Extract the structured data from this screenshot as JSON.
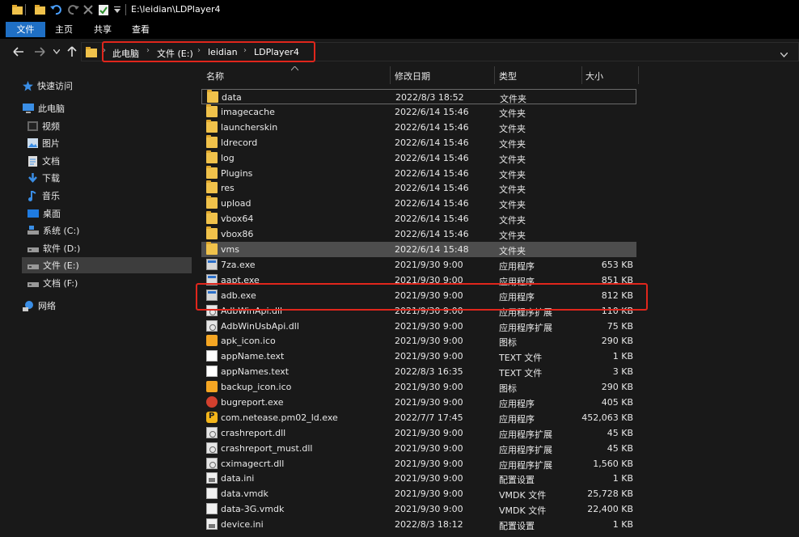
{
  "window": {
    "title": "E:\\leidian\\LDPlayer4"
  },
  "ribbon": {
    "tabs": [
      "文件",
      "主页",
      "共享",
      "查看"
    ]
  },
  "address": {
    "crumbs": [
      "此电脑",
      "文件 (E:)",
      "leidian",
      "LDPlayer4"
    ]
  },
  "nav": {
    "quick_access": "快速访问",
    "this_pc": "此电脑",
    "items": [
      "视频",
      "图片",
      "文档",
      "下载",
      "音乐",
      "桌面",
      "系统 (C:)",
      "软件 (D:)",
      "文件 (E:)",
      "文档 (F:)"
    ],
    "network": "网络"
  },
  "columns": {
    "name": "名称",
    "date": "修改日期",
    "type": "类型",
    "size": "大小"
  },
  "files": [
    {
      "name": "data",
      "date": "2022/8/3 18:52",
      "type": "文件夹",
      "size": "",
      "icon": "folder"
    },
    {
      "name": "imagecache",
      "date": "2022/6/14 15:46",
      "type": "文件夹",
      "size": "",
      "icon": "folder"
    },
    {
      "name": "launcherskin",
      "date": "2022/6/14 15:46",
      "type": "文件夹",
      "size": "",
      "icon": "folder"
    },
    {
      "name": "ldrecord",
      "date": "2022/6/14 15:46",
      "type": "文件夹",
      "size": "",
      "icon": "folder"
    },
    {
      "name": "log",
      "date": "2022/6/14 15:46",
      "type": "文件夹",
      "size": "",
      "icon": "folder"
    },
    {
      "name": "Plugins",
      "date": "2022/6/14 15:46",
      "type": "文件夹",
      "size": "",
      "icon": "folder"
    },
    {
      "name": "res",
      "date": "2022/6/14 15:46",
      "type": "文件夹",
      "size": "",
      "icon": "folder"
    },
    {
      "name": "upload",
      "date": "2022/6/14 15:46",
      "type": "文件夹",
      "size": "",
      "icon": "folder"
    },
    {
      "name": "vbox64",
      "date": "2022/6/14 15:46",
      "type": "文件夹",
      "size": "",
      "icon": "folder"
    },
    {
      "name": "vbox86",
      "date": "2022/6/14 15:46",
      "type": "文件夹",
      "size": "",
      "icon": "folder"
    },
    {
      "name": "vms",
      "date": "2022/6/14 15:48",
      "type": "文件夹",
      "size": "",
      "icon": "folder"
    },
    {
      "name": "7za.exe",
      "date": "2021/9/30 9:00",
      "type": "应用程序",
      "size": "653 KB",
      "icon": "exe"
    },
    {
      "name": "aapt.exe",
      "date": "2021/9/30 9:00",
      "type": "应用程序",
      "size": "851 KB",
      "icon": "exe"
    },
    {
      "name": "adb.exe",
      "date": "2021/9/30 9:00",
      "type": "应用程序",
      "size": "812 KB",
      "icon": "exe"
    },
    {
      "name": "AdbWinApi.dll",
      "date": "2021/9/30 9:00",
      "type": "应用程序扩展",
      "size": "110 KB",
      "icon": "dll"
    },
    {
      "name": "AdbWinUsbApi.dll",
      "date": "2021/9/30 9:00",
      "type": "应用程序扩展",
      "size": "75 KB",
      "icon": "dll"
    },
    {
      "name": "apk_icon.ico",
      "date": "2021/9/30 9:00",
      "type": "图标",
      "size": "290 KB",
      "icon": "ico"
    },
    {
      "name": "appName.text",
      "date": "2021/9/30 9:00",
      "type": "TEXT 文件",
      "size": "1 KB",
      "icon": "txt"
    },
    {
      "name": "appNames.text",
      "date": "2022/8/3 16:35",
      "type": "TEXT 文件",
      "size": "3 KB",
      "icon": "txt"
    },
    {
      "name": "backup_icon.ico",
      "date": "2021/9/30 9:00",
      "type": "图标",
      "size": "290 KB",
      "icon": "ico"
    },
    {
      "name": "bugreport.exe",
      "date": "2021/9/30 9:00",
      "type": "应用程序",
      "size": "405 KB",
      "icon": "bug"
    },
    {
      "name": "com.netease.pm02_ld.exe",
      "date": "2022/7/7 17:45",
      "type": "应用程序",
      "size": "452,063 KB",
      "icon": "pubg"
    },
    {
      "name": "crashreport.dll",
      "date": "2021/9/30 9:00",
      "type": "应用程序扩展",
      "size": "45 KB",
      "icon": "dll"
    },
    {
      "name": "crashreport_must.dll",
      "date": "2021/9/30 9:00",
      "type": "应用程序扩展",
      "size": "45 KB",
      "icon": "dll"
    },
    {
      "name": "cximagecrt.dll",
      "date": "2021/9/30 9:00",
      "type": "应用程序扩展",
      "size": "1,560 KB",
      "icon": "dll"
    },
    {
      "name": "data.ini",
      "date": "2021/9/30 9:00",
      "type": "配置设置",
      "size": "1 KB",
      "icon": "ini"
    },
    {
      "name": "data.vmdk",
      "date": "2021/9/30 9:00",
      "type": "VMDK 文件",
      "size": "25,728 KB",
      "icon": "vmdk"
    },
    {
      "name": "data-3G.vmdk",
      "date": "2021/9/30 9:00",
      "type": "VMDK 文件",
      "size": "22,400 KB",
      "icon": "vmdk"
    },
    {
      "name": "device.ini",
      "date": "2022/8/3 18:12",
      "type": "配置设置",
      "size": "1 KB",
      "icon": "ini"
    }
  ],
  "colors": {
    "accent": "#1f6fc4",
    "highlight": "#e0261c",
    "folder": "#f0c24b"
  }
}
